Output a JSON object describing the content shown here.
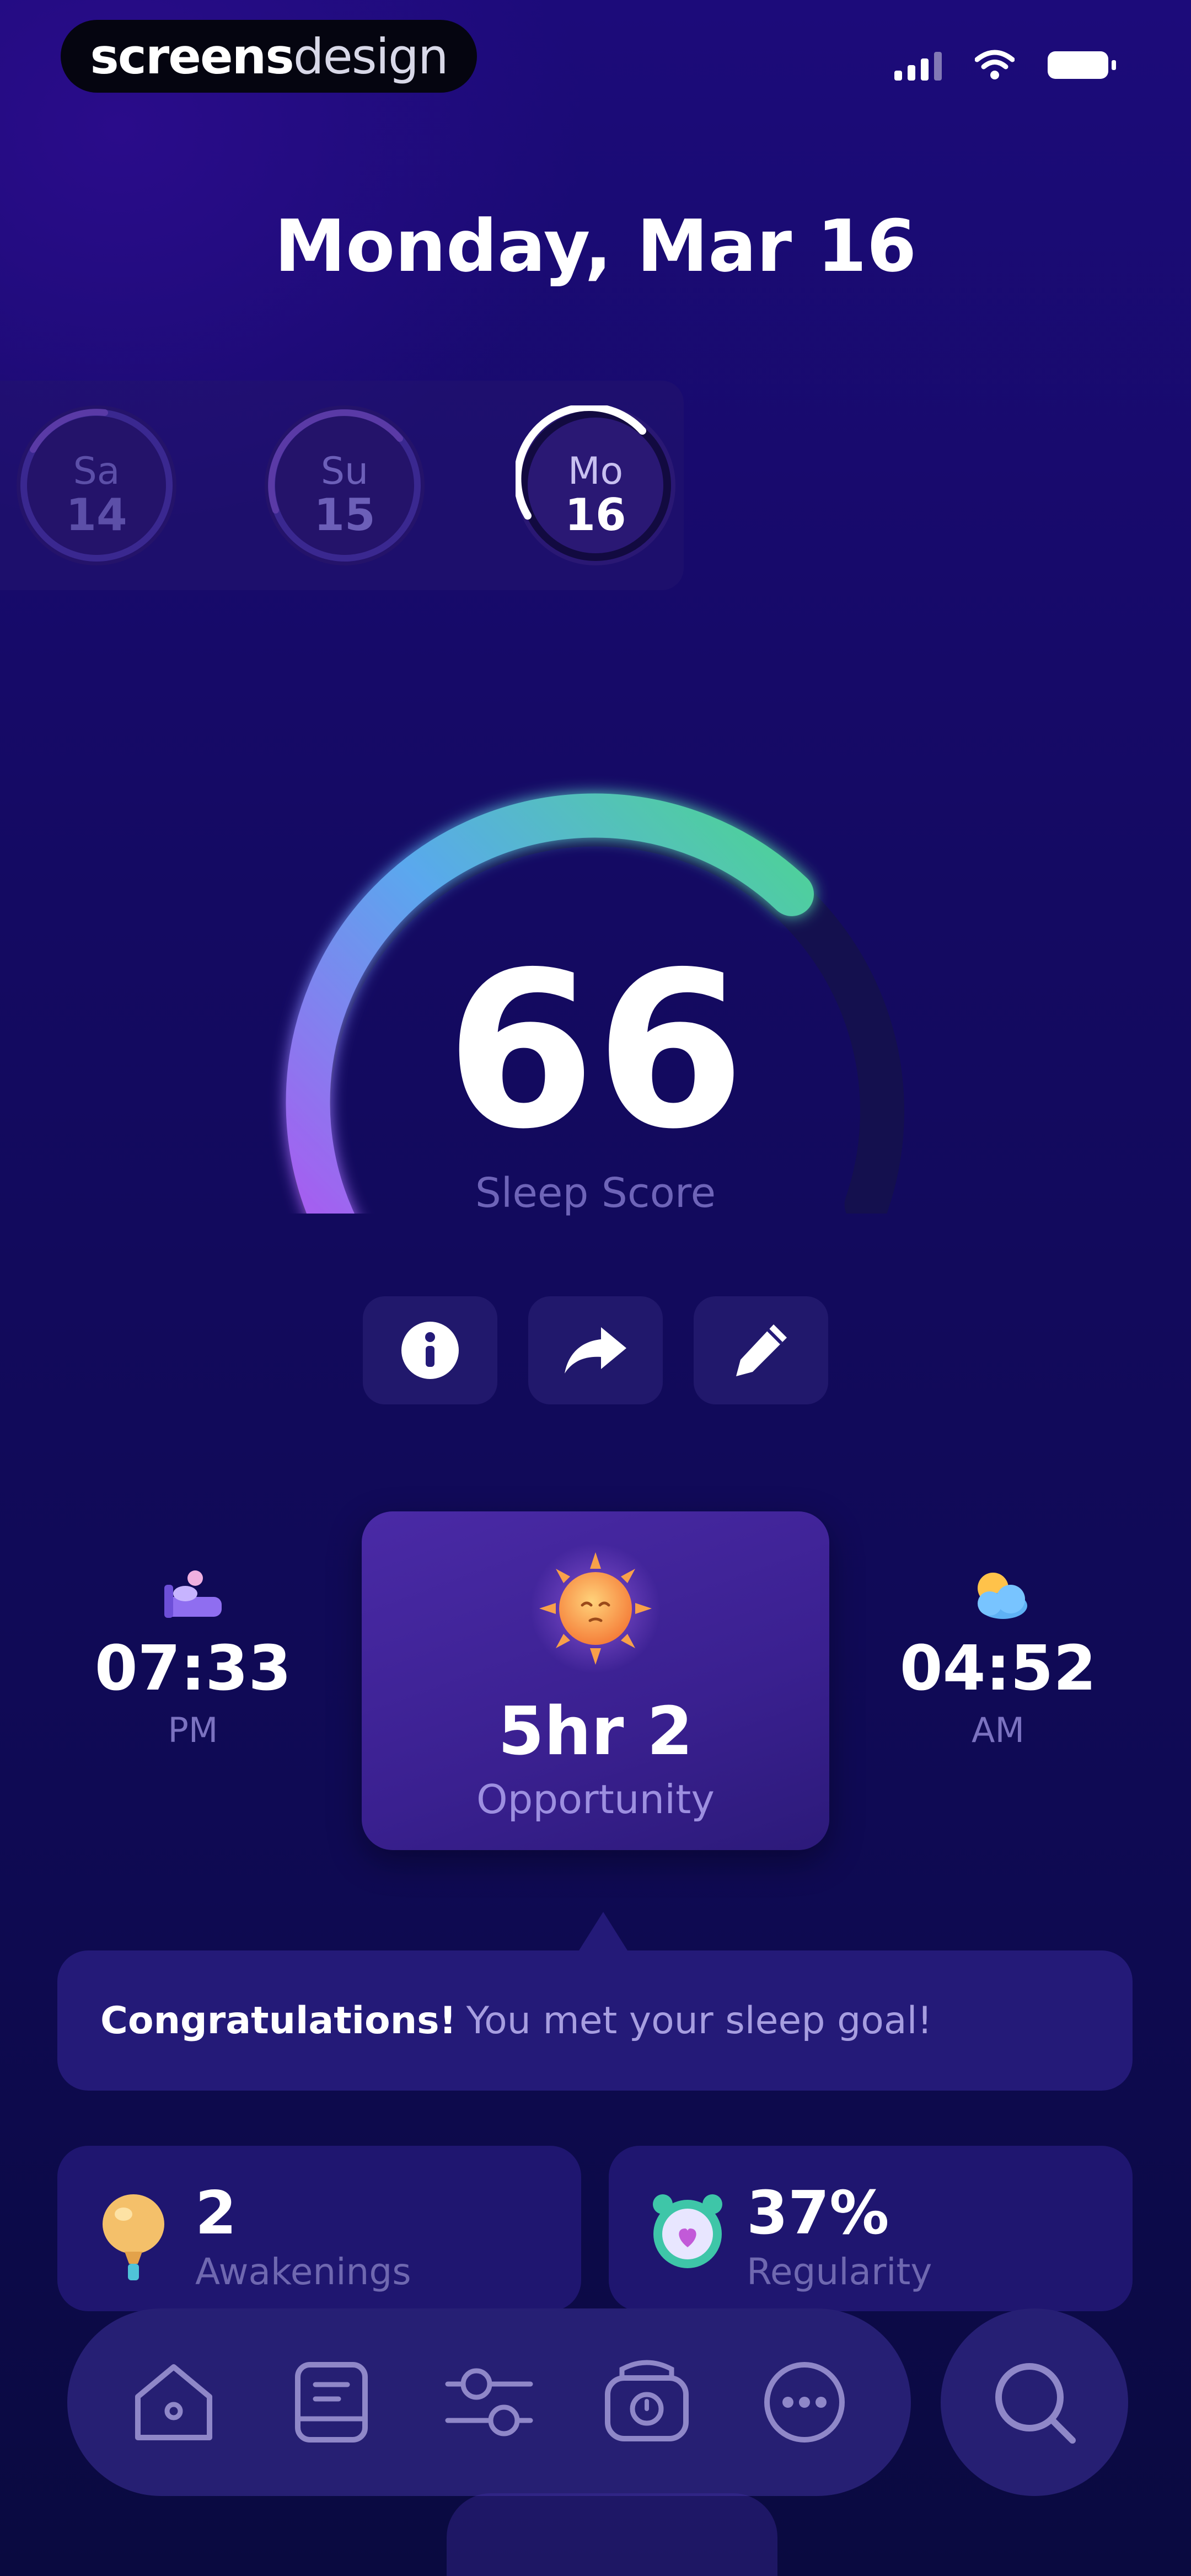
{
  "status_bar": {
    "brand_part1": "screens",
    "brand_part2": "design"
  },
  "header": {
    "date": "Monday, Mar 16"
  },
  "days": [
    {
      "weekday": "Sa",
      "day": "14"
    },
    {
      "weekday": "Su",
      "day": "15"
    },
    {
      "weekday": "Mo",
      "day": "16"
    }
  ],
  "sleep": {
    "score": "66",
    "score_label": "Sleep Score",
    "score_value": 66,
    "score_max": 100
  },
  "actions": {
    "info_icon": "info-icon",
    "share_icon": "share-icon",
    "edit_icon": "pencil-icon"
  },
  "bedtime": {
    "time": "07:33",
    "period": "PM",
    "icon": "bed-icon"
  },
  "opportunity": {
    "value": "5hr 2",
    "label": "Opportunity",
    "icon": "sun-icon"
  },
  "waketime": {
    "time": "04:52",
    "period": "AM",
    "icon": "cloud-sun-icon"
  },
  "message": {
    "strong": "Congratulations!",
    "text": "You met your sleep goal!"
  },
  "stats": [
    {
      "value": "2",
      "label": "Awakenings",
      "icon": "balloon-icon"
    },
    {
      "value": "37%",
      "label": "Regularity",
      "icon": "alarm-clock-icon"
    }
  ],
  "nav": {
    "items": [
      "home-icon",
      "journal-icon",
      "sliders-icon",
      "smart-alarm-icon",
      "more-icon"
    ],
    "search": "search-icon"
  },
  "colors": {
    "gauge_start": "#b54ff0",
    "gauge_mid": "#5aa8ee",
    "gauge_end": "#4ed493",
    "background_top": "#1c0b7a",
    "background_bottom": "#0a0a40"
  }
}
